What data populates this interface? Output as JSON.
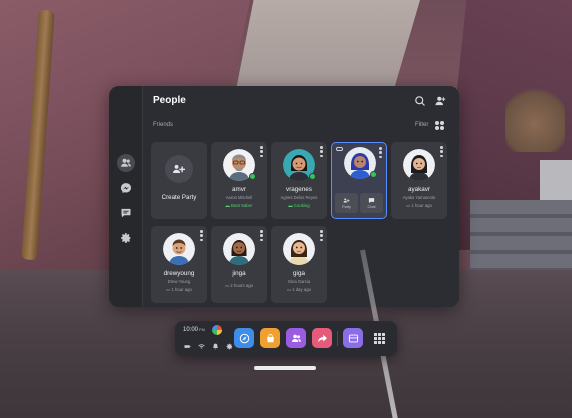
{
  "panel": {
    "title": "People",
    "section_label": "Friends",
    "filter_label": "Filter"
  },
  "side_rail": [
    {
      "name": "people-icon",
      "active": true
    },
    {
      "name": "messenger-icon",
      "active": false
    },
    {
      "name": "chat-icon",
      "active": false
    },
    {
      "name": "settings-icon",
      "active": false
    }
  ],
  "create_party": {
    "label": "Create Party"
  },
  "friends": [
    {
      "username": "amvr",
      "full_name": "Aaron Mitchell",
      "status": "Beat Saber",
      "status_color": "#4cd16f",
      "online": true
    },
    {
      "username": "vragenes",
      "full_name": "Agnes Delos Reyes",
      "status": "Cooking",
      "status_color": "#4cd16f",
      "online": true
    },
    {
      "username": "",
      "full_name": "",
      "status": "",
      "online": true,
      "selected": true,
      "actions": [
        {
          "label": "Party"
        },
        {
          "label": "Chat"
        }
      ]
    },
    {
      "username": "ayakavr",
      "full_name": "Ayako Yamamoto",
      "status": "1 hour ago",
      "online": false
    },
    {
      "username": "drewyoung",
      "full_name": "Drew Young",
      "status": "1 hour ago",
      "online": false
    },
    {
      "username": "jinga",
      "full_name": "",
      "status": "2 hours ago",
      "online": false
    },
    {
      "username": "giga",
      "full_name": "Gina Garcia",
      "status": "1 day ago",
      "online": false
    }
  ],
  "dock": {
    "clock": "10:00",
    "ampm": "PM",
    "apps": [
      {
        "name": "explore-app-icon",
        "color": "#3d8ee8"
      },
      {
        "name": "store-app-icon",
        "color": "#f0a030"
      },
      {
        "name": "people-app-icon",
        "color": "#9a5ce0"
      },
      {
        "name": "share-app-icon",
        "color": "#e65a7a"
      },
      {
        "name": "window-app-icon",
        "color": "#8a6ee8"
      }
    ]
  }
}
